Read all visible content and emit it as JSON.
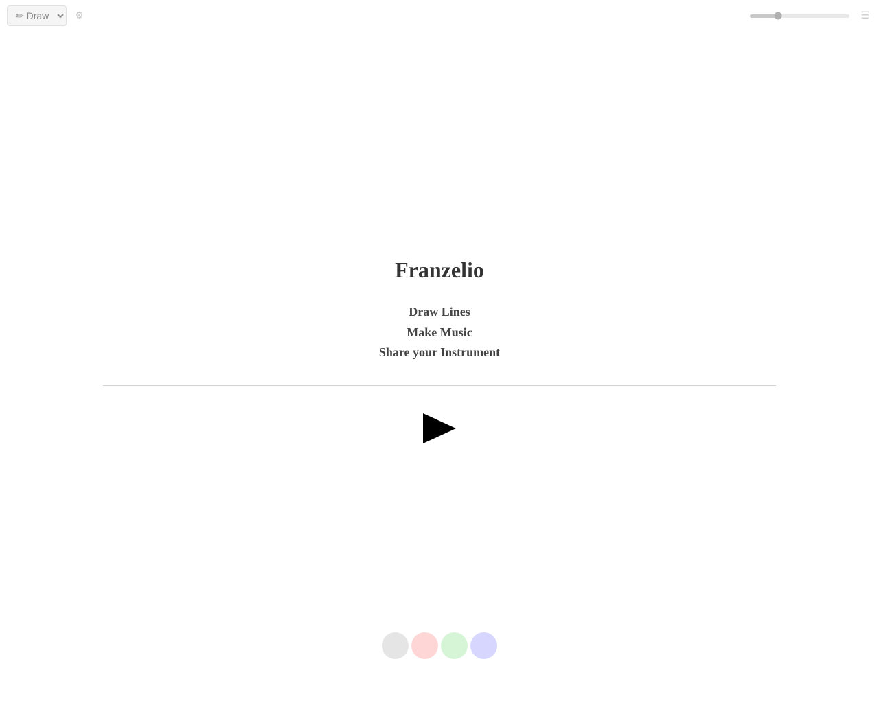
{
  "toolbar": {
    "draw_label": "✏ Draw",
    "slider_value": 30
  },
  "main": {
    "title": "Franzelio",
    "taglines": [
      "Draw Lines",
      "Make Music",
      "Share your Instrument"
    ]
  },
  "colors": {
    "gray": "#e5e5e5",
    "red": "#ffd6d6",
    "green": "#d6f5d6",
    "blue": "#d6d6ff"
  }
}
